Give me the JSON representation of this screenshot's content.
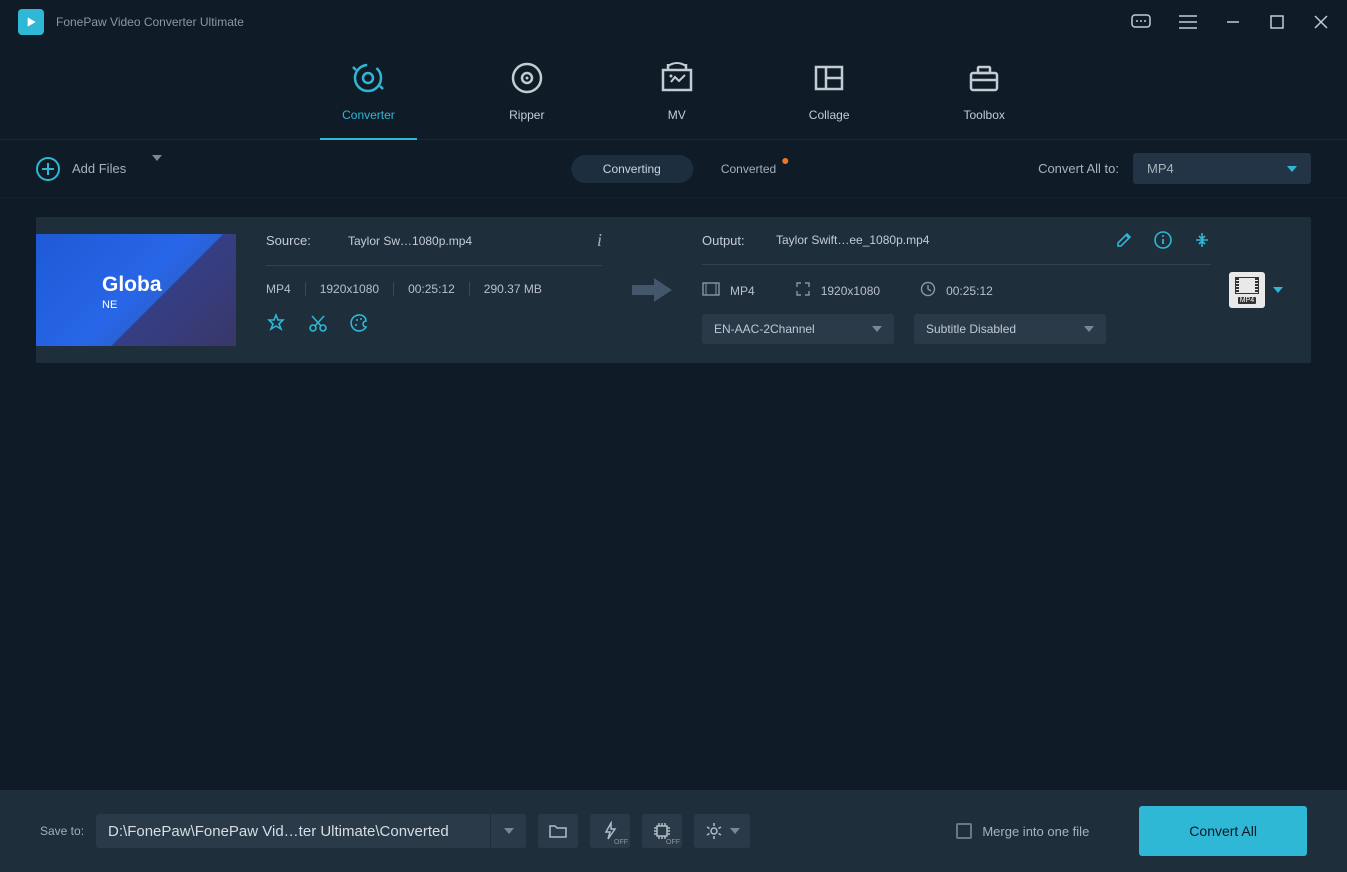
{
  "app_title": "FonePaw Video Converter Ultimate",
  "nav": {
    "converter": "Converter",
    "ripper": "Ripper",
    "mv": "MV",
    "collage": "Collage",
    "toolbox": "Toolbox"
  },
  "toolbar": {
    "add_files": "Add Files",
    "converting": "Converting",
    "converted": "Converted",
    "convert_all_to": "Convert All to:",
    "format": "MP4"
  },
  "file": {
    "thumb_logo": "Globa",
    "thumb_sub": "NE",
    "source_label": "Source:",
    "source_name": "Taylor Sw…1080p.mp4",
    "format": "MP4",
    "resolution": "1920x1080",
    "duration": "00:25:12",
    "size": "290.37 MB",
    "output_label": "Output:",
    "output_name": "Taylor Swift…ee_1080p.mp4",
    "out_format": "MP4",
    "out_resolution": "1920x1080",
    "out_duration": "00:25:12",
    "audio_select": "EN-AAC-2Channel",
    "subtitle_select": "Subtitle Disabled",
    "format_badge": "MP4"
  },
  "bottom": {
    "save_to": "Save to:",
    "path": "D:\\FonePaw\\FonePaw Vid…ter Ultimate\\Converted",
    "off": "OFF",
    "merge": "Merge into one file",
    "convert_all": "Convert All"
  }
}
